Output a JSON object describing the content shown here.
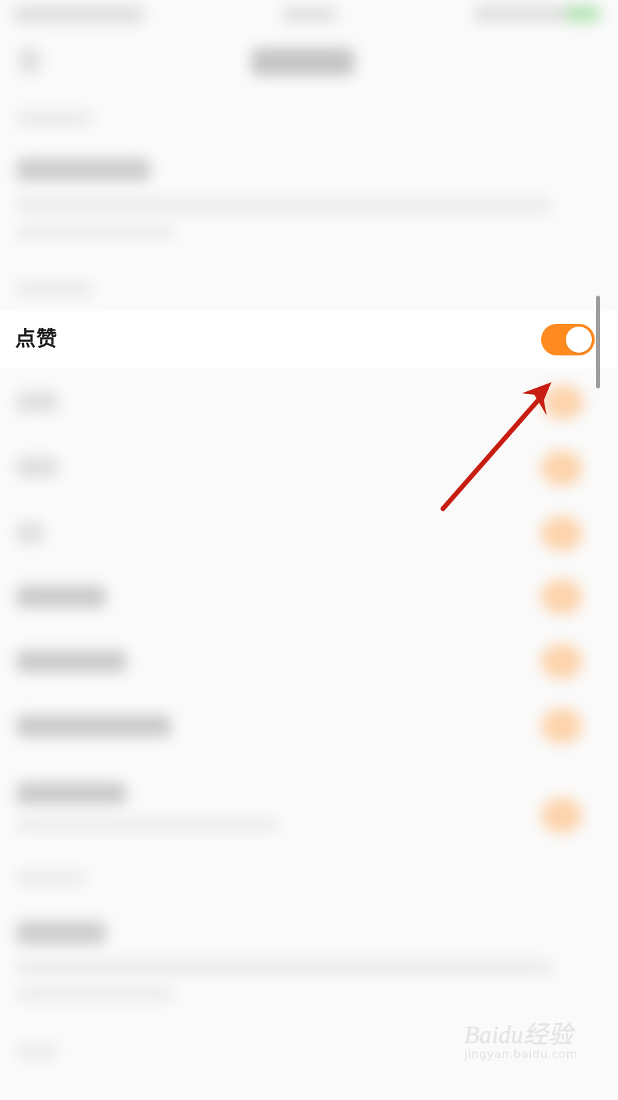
{
  "setting_row": {
    "label": "点赞",
    "toggle_on": true
  },
  "colors": {
    "toggle_on": "#ff8a1f",
    "annotation_arrow": "#c81d12",
    "focus_row_background": "#ffffff"
  },
  "watermark": {
    "logo_text": "Baidu经验",
    "url": "jingyan.baidu.com"
  }
}
